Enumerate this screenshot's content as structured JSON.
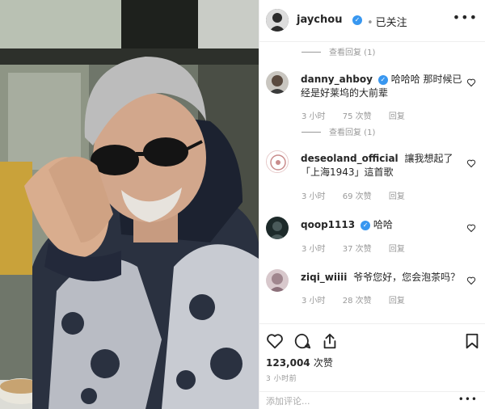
{
  "post": {
    "author": "jaychou",
    "follow_status": "已关注",
    "more_glyph": "•••",
    "top_reply_toggle": "查看回复 (1)"
  },
  "comments": [
    {
      "username": "danny_ahboy",
      "verified": true,
      "text": "哈哈哈 那时候已经是好莱坞的大前辈",
      "time": "3 小时",
      "likes": "75 次赞",
      "reply": "回复",
      "replies_toggle": "查看回复 (1)"
    },
    {
      "username": "deseoland_official",
      "verified": false,
      "text": "讓我想起了「上海1943」這首歌",
      "time": "3 小时",
      "likes": "69 次赞",
      "reply": "回复"
    },
    {
      "username": "qoop1113",
      "verified": true,
      "text": "哈哈",
      "time": "3 小时",
      "likes": "37 次赞",
      "reply": "回复"
    },
    {
      "username": "ziqi_wiiii",
      "verified": false,
      "text": "爷爷您好，您会泡茶吗？",
      "time": "3 小时",
      "likes": "28 次赞",
      "reply": "回复"
    }
  ],
  "footer": {
    "likes_count": "123,004",
    "likes_suffix": "次赞",
    "posted_time": "3 小时前",
    "comment_placeholder": "添加评论...",
    "more_glyph": "•••"
  },
  "icons": {
    "verified": "verified-badge-icon",
    "like": "heart-icon",
    "comment": "comment-bubble-icon",
    "share": "share-upload-icon",
    "save": "bookmark-icon"
  },
  "colors": {
    "verified_blue": "#3897f0",
    "text_primary": "#262626",
    "text_secondary": "#999999",
    "divider": "#efefef"
  }
}
